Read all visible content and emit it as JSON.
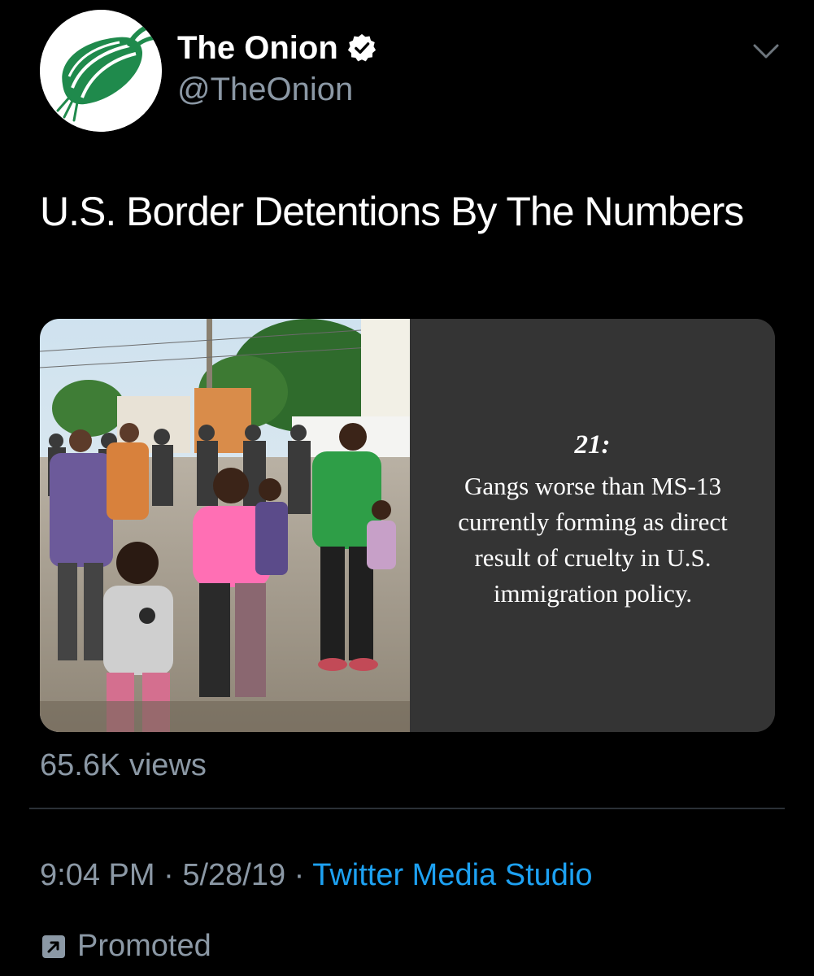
{
  "tweet": {
    "display_name": "The Onion",
    "handle": "@TheOnion",
    "verified": true,
    "text": "U.S. Border Detentions By The Numbers",
    "media": {
      "number": "21:",
      "fact": "Gangs worse than MS-13 currently forming as direct result of cruelty in U.S. immigration policy."
    },
    "views": "65.6K views",
    "time": "9:04 PM",
    "date": "5/28/19",
    "separator": "·",
    "source": "Twitter Media Studio",
    "promoted_label": "Promoted"
  },
  "icons": {
    "avatar": "onion-logo-icon",
    "verified": "verified-badge-icon",
    "caret": "chevron-down-icon",
    "promoted": "promoted-arrow-icon"
  },
  "colors": {
    "background": "#000000",
    "text_primary": "#ffffff",
    "text_secondary": "#8b98a5",
    "link": "#1da1f2",
    "onion_green": "#1f8a4c",
    "divider": "#2b3036"
  }
}
